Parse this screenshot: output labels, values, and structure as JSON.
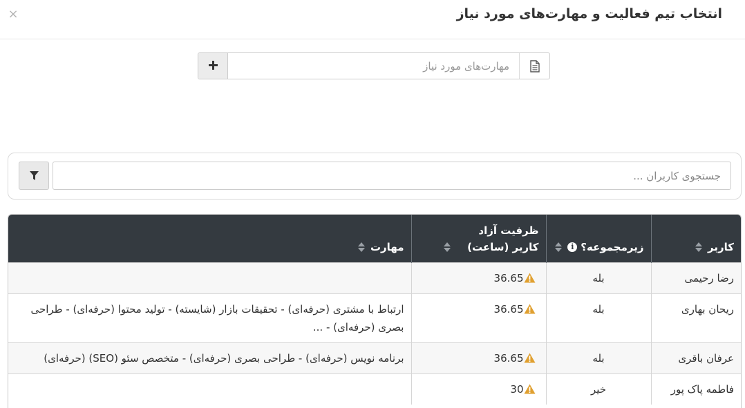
{
  "modal": {
    "title": "انتخاب تیم فعالیت و مهارت‌های مورد نیاز",
    "close_label": "×"
  },
  "skills": {
    "placeholder": "مهارت‌های مورد نیاز",
    "value": "",
    "add_label": "+",
    "doc_icon": "document-icon"
  },
  "search": {
    "placeholder": "جستجوی کاربران ...",
    "value": "",
    "filter_icon": "filter-icon"
  },
  "table": {
    "header_bg": "#343a40",
    "warning_color": "#e0a030",
    "columns": {
      "user": "کاربر",
      "subset": "زیرمجموعه؟",
      "capacity": "ظرفیت آزاد کاربر (ساعت)",
      "skills": "مهارت"
    },
    "rows": [
      {
        "user": "رضا رحیمی",
        "subset": "بله",
        "capacity": "36.65",
        "skills": ""
      },
      {
        "user": "ریحان بهاری",
        "subset": "بله",
        "capacity": "36.65",
        "skills": "ارتباط با مشتری (حرفه‌ای) - تحقیقات بازار (شایسته) - تولید محتوا (حرفه‌ای) - طراحی بصری (حرفه‌ای) - ..."
      },
      {
        "user": "عرفان باقری",
        "subset": "بله",
        "capacity": "36.65",
        "skills": "برنامه نویس (حرفه‌ای) - طراحی بصری (حرفه‌ای) - متخصص سئو (SEO) (حرفه‌ای)"
      },
      {
        "user": "فاطمه پاک پور",
        "subset": "خیر",
        "capacity": "30",
        "skills": ""
      }
    ]
  }
}
